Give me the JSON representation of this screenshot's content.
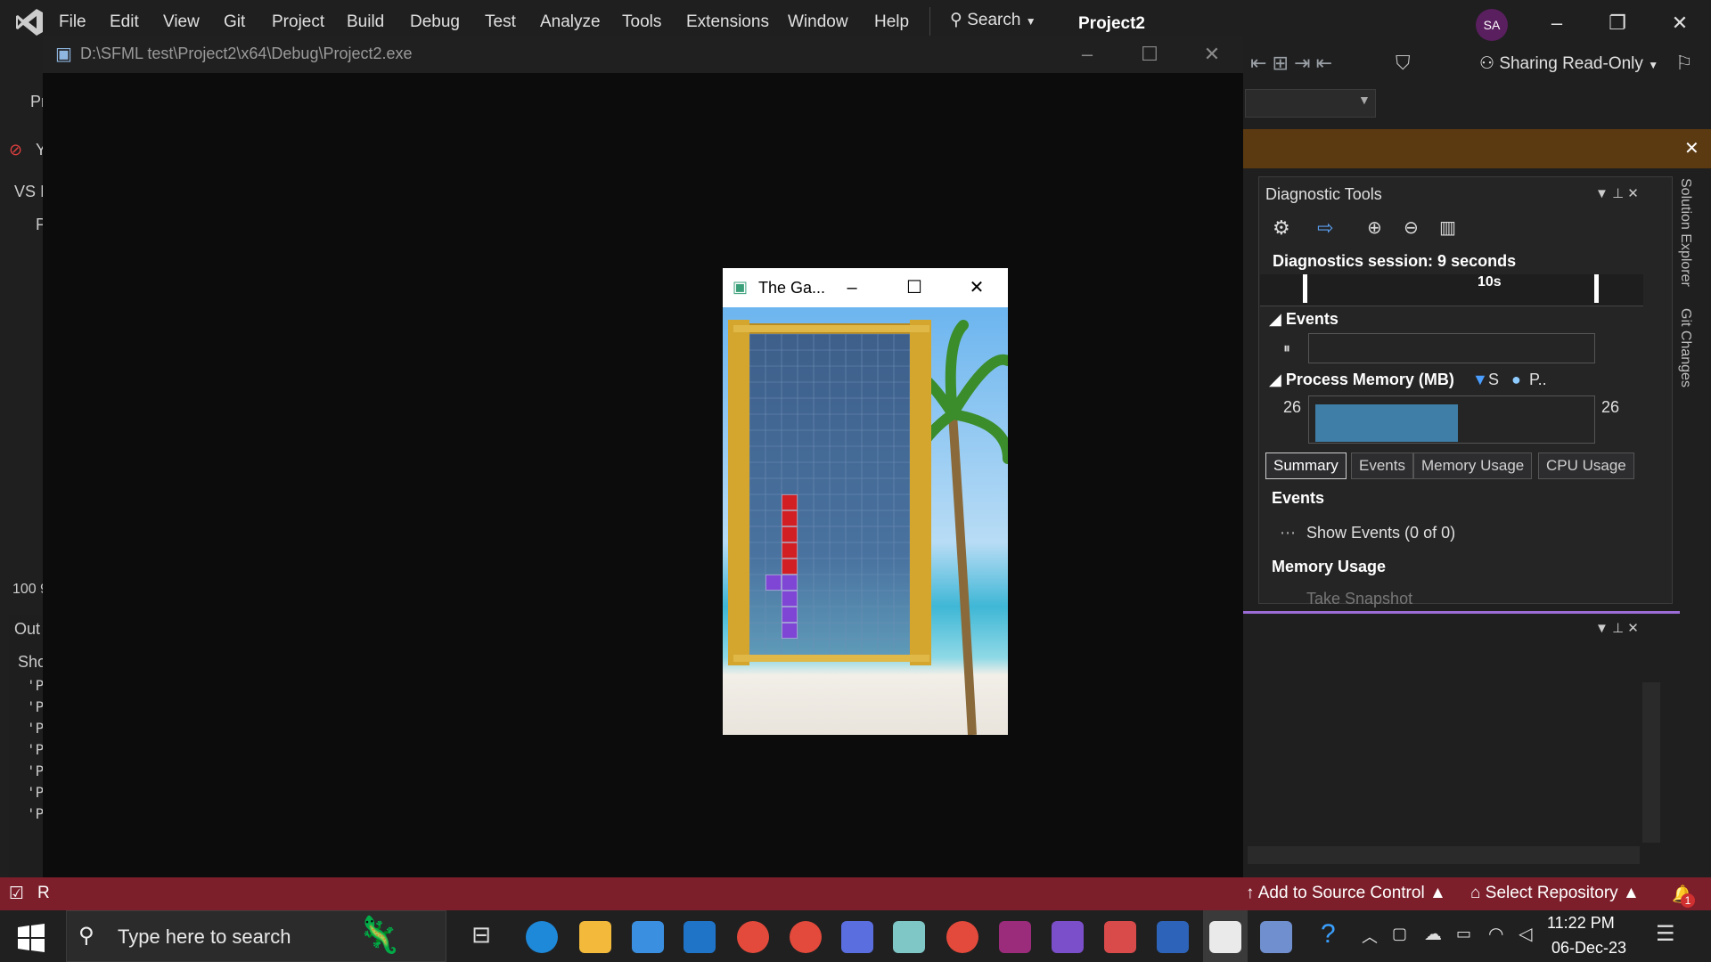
{
  "vs": {
    "menu": [
      "File",
      "Edit",
      "View",
      "Git",
      "Project",
      "Build",
      "Debug",
      "Test",
      "Analyze",
      "Tools",
      "Extensions",
      "Window",
      "Help"
    ],
    "search_label": "Search",
    "project_name": "Project2",
    "avatar_initials": "SA",
    "sharing_label": "Sharing Read-Only",
    "left_labels": {
      "pr": "Pr",
      "y": "Y",
      "vs": "VS I",
      "p": "P",
      "zoom": "100 9",
      "out": "Out",
      "sho": "Sho",
      "line_prefix": "'P"
    },
    "vertical_tabs": [
      "Solution Explorer",
      "Git Changes"
    ],
    "status": {
      "add_source": "Add to Source Control",
      "select_repo": "Select Repository",
      "notif_count": "1",
      "left": "R"
    }
  },
  "diagnostics": {
    "title": "Diagnostic Tools",
    "session": "Diagnostics session: 9 seconds",
    "ruler_label": "10s",
    "events_header": "Events",
    "process_memory_header": "Process Memory (MB)",
    "legend_s": "S",
    "legend_p": "P..",
    "mem_left": "26",
    "mem_right": "26",
    "tabs": [
      "Summary",
      "Events",
      "Memory Usage",
      "CPU Usage"
    ],
    "summary_events": "Events",
    "show_events": "Show Events (0 of 0)",
    "memory_usage": "Memory Usage",
    "take_snapshot": "Take Snapshot"
  },
  "console": {
    "title": "D:\\SFML test\\Project2\\x64\\Debug\\Project2.exe"
  },
  "game": {
    "title": "The Ga...",
    "grid_cols": 10,
    "grid_rows": 20,
    "red_cells": [
      [
        2,
        10
      ],
      [
        2,
        11
      ],
      [
        2,
        12
      ],
      [
        2,
        13
      ],
      [
        2,
        14
      ]
    ],
    "purple_cells": [
      [
        1,
        15
      ],
      [
        2,
        15
      ],
      [
        2,
        16
      ],
      [
        2,
        17
      ],
      [
        2,
        18
      ]
    ],
    "colors": {
      "red": "#d21f24",
      "purple": "#7f45d4",
      "frame": "#d4a62e",
      "sky": "#7ec1f0",
      "sea": "#3fb7d6"
    }
  },
  "taskbar": {
    "search_placeholder": "Type here to search",
    "time": "11:22 PM",
    "date": "06-Dec-23",
    "icons": [
      "task-view-icon",
      "edge-icon",
      "file-explorer-icon",
      "store-icon",
      "mail-icon",
      "chrome-profile-1-icon",
      "chrome-profile-2-icon",
      "copilot-icon",
      "app-icon",
      "chrome-profile-3-icon",
      "winrar-icon",
      "visual-studio-icon",
      "paint-icon",
      "devcpp-icon",
      "active-window-icon",
      "pen-icon"
    ]
  },
  "colors": {
    "status_bar": "#7d1f2b",
    "vs_bg": "#1f1f1f",
    "accent": "#9b6cd6"
  }
}
